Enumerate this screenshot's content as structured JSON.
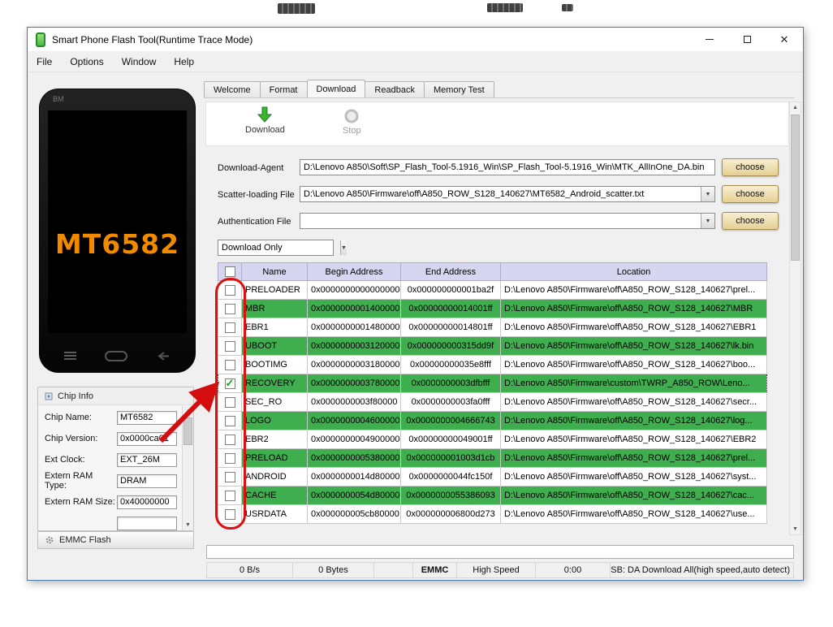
{
  "window": {
    "title": "Smart Phone Flash Tool(Runtime Trace Mode)",
    "menu": [
      "File",
      "Options",
      "Window",
      "Help"
    ]
  },
  "phone": {
    "bezel_label": "BM",
    "screen_label": "MT6582"
  },
  "chip_info": {
    "title": "Chip Info",
    "fields": [
      {
        "label": "Chip Name:",
        "value": "MT6582"
      },
      {
        "label": "Chip Version:",
        "value": "0x0000ca01"
      },
      {
        "label": "Ext Clock:",
        "value": "EXT_26M"
      },
      {
        "label": "Extern RAM Type:",
        "value": "DRAM"
      },
      {
        "label": "Extern RAM Size:",
        "value": "0x40000000"
      }
    ]
  },
  "emmc_flash": {
    "label": "EMMC Flash"
  },
  "tabs": {
    "items": [
      "Welcome",
      "Format",
      "Download",
      "Readback",
      "Memory Test"
    ],
    "active": "Download"
  },
  "toolbar": {
    "download_label": "Download",
    "stop_label": "Stop"
  },
  "form": {
    "download_agent_label": "Download-Agent",
    "download_agent_value": "D:\\Lenovo A850\\Soft\\SP_Flash_Tool-5.1916_Win\\SP_Flash_Tool-5.1916_Win\\MTK_AllInOne_DA.bin",
    "scatter_label": "Scatter-loading File",
    "scatter_value": "D:\\Lenovo A850\\Firmware\\off\\A850_ROW_S128_140627\\MT6582_Android_scatter.txt",
    "auth_label": "Authentication File",
    "auth_value": "",
    "choose_label": "choose",
    "mode_value": "Download Only"
  },
  "table": {
    "select_all": false,
    "headers": [
      "Name",
      "Begin Address",
      "End Address",
      "Location"
    ],
    "rows": [
      {
        "name": "PRELOADER",
        "begin": "0x0000000000000000",
        "end": "0x000000000001ba2f",
        "location": "D:\\Lenovo A850\\Firmware\\off\\A850_ROW_S128_140627\\prel...",
        "checked": false
      },
      {
        "name": "MBR",
        "begin": "0x0000000001400000",
        "end": "0x00000000014001ff",
        "location": "D:\\Lenovo A850\\Firmware\\off\\A850_ROW_S128_140627\\MBR",
        "checked": false
      },
      {
        "name": "EBR1",
        "begin": "0x0000000001480000",
        "end": "0x00000000014801ff",
        "location": "D:\\Lenovo A850\\Firmware\\off\\A850_ROW_S128_140627\\EBR1",
        "checked": false
      },
      {
        "name": "UBOOT",
        "begin": "0x0000000003120000",
        "end": "0x000000000315dd9f",
        "location": "D:\\Lenovo A850\\Firmware\\off\\A850_ROW_S128_140627\\lk.bin",
        "checked": false
      },
      {
        "name": "BOOTIMG",
        "begin": "0x0000000003180000",
        "end": "0x00000000035e8fff",
        "location": "D:\\Lenovo A850\\Firmware\\off\\A850_ROW_S128_140627\\boo...",
        "checked": false
      },
      {
        "name": "RECOVERY",
        "begin": "0x0000000003780000",
        "end": "0x0000000003dfbfff",
        "location": "D:\\Lenovo A850\\Firmware\\custom\\TWRP_A850_ROW\\Leno...",
        "checked": true
      },
      {
        "name": "SEC_RO",
        "begin": "0x0000000003f80000",
        "end": "0x0000000003fa0fff",
        "location": "D:\\Lenovo A850\\Firmware\\off\\A850_ROW_S128_140627\\secr...",
        "checked": false
      },
      {
        "name": "LOGO",
        "begin": "0x0000000004600000",
        "end": "0x0000000004666743",
        "location": "D:\\Lenovo A850\\Firmware\\off\\A850_ROW_S128_140627\\log...",
        "checked": false
      },
      {
        "name": "EBR2",
        "begin": "0x0000000004900000",
        "end": "0x00000000049001ff",
        "location": "D:\\Lenovo A850\\Firmware\\off\\A850_ROW_S128_140627\\EBR2",
        "checked": false
      },
      {
        "name": "PRELOAD",
        "begin": "0x0000000005380000",
        "end": "0x000000001003d1cb",
        "location": "D:\\Lenovo A850\\Firmware\\off\\A850_ROW_S128_140627\\prel...",
        "checked": false
      },
      {
        "name": "ANDROID",
        "begin": "0x0000000014d80000",
        "end": "0x0000000044fc150f",
        "location": "D:\\Lenovo A850\\Firmware\\off\\A850_ROW_S128_140627\\syst...",
        "checked": false
      },
      {
        "name": "CACHE",
        "begin": "0x0000000054d80000",
        "end": "0x0000000055386093",
        "location": "D:\\Lenovo A850\\Firmware\\off\\A850_ROW_S128_140627\\cac...",
        "checked": false
      },
      {
        "name": "USRDATA",
        "begin": "0x000000005cb80000",
        "end": "0x000000006800d273",
        "location": "D:\\Lenovo A850\\Firmware\\off\\A850_ROW_S128_140627\\use...",
        "checked": false
      }
    ]
  },
  "statusbar": {
    "speed": "0 B/s",
    "bytes": "0 Bytes",
    "storage": "EMMC",
    "speed_mode": "High Speed",
    "time": "0:00",
    "usb": "USB: DA Download All(high speed,auto detect)"
  },
  "colors": {
    "row_green": "#3fae4e",
    "header_lavender": "#d6d6f0",
    "annotation_red": "#dd1010",
    "phone_label_orange": "#f28a00"
  }
}
